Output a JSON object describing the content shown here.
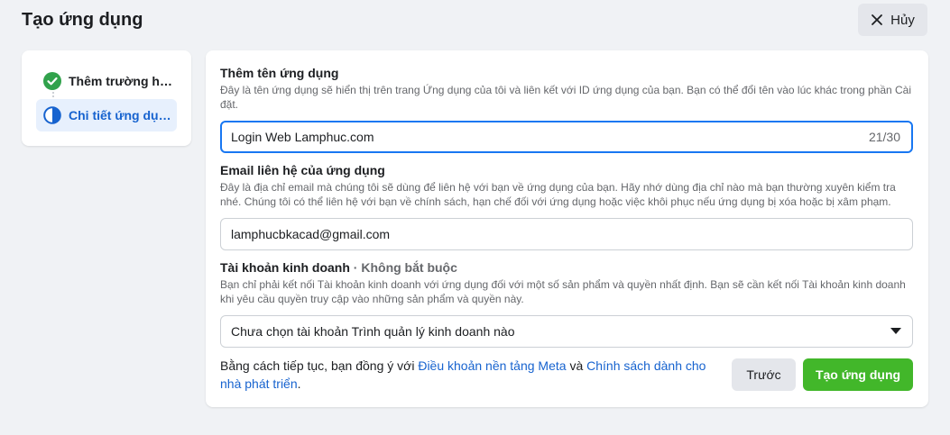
{
  "header": {
    "title": "Tạo ứng dụng",
    "cancel_label": "Hủy"
  },
  "steps": [
    {
      "label": "Thêm trường hợp sử dụng",
      "status": "completed",
      "icon": "check-circle-icon"
    },
    {
      "label": "Chi tiết ứng dụng",
      "status": "active",
      "icon": "half-circle-icon"
    }
  ],
  "form": {
    "app_name": {
      "title": "Thêm tên ứng dụng",
      "description": "Đây là tên ứng dụng sẽ hiển thị trên trang Ứng dụng của tôi và liên kết với ID ứng dụng của bạn. Bạn có thể đổi tên vào lúc khác trong phần Cài đặt.",
      "value": "Login Web Lamphuc.com",
      "counter": "21/30"
    },
    "contact_email": {
      "title": "Email liên hệ của ứng dụng",
      "description": "Đây là địa chỉ email mà chúng tôi sẽ dùng để liên hệ với bạn về ứng dụng của bạn. Hãy nhớ dùng địa chỉ nào mà bạn thường xuyên kiểm tra nhé. Chúng tôi có thể liên hệ với bạn về chính sách, hạn chế đối với ứng dụng hoặc việc khôi phục nếu ứng dụng bị xóa hoặc bị xâm phạm.",
      "value": "lamphucbkacad@gmail.com"
    },
    "business_account": {
      "title": "Tài khoản kinh doanh",
      "optional_label": "· Không bắt buộc",
      "description": "Bạn chỉ phải kết nối Tài khoản kinh doanh với ứng dụng đối với một số sản phẩm và quyền nhất định. Bạn sẽ cần kết nối Tài khoản kinh doanh khi yêu cầu quyền truy cập vào những sản phẩm và quyền này.",
      "selected": "Chưa chọn tài khoản Trình quản lý kinh doanh nào"
    }
  },
  "footer": {
    "terms_prefix": "Bằng cách tiếp tục, bạn đồng ý với ",
    "terms_link": "Điều khoản nền tảng Meta",
    "terms_middle": " và ",
    "policy_link": "Chính sách dành cho nhà phát triển",
    "terms_suffix": ".",
    "back_label": "Trước",
    "create_label": "Tạo ứng dụng"
  },
  "colors": {
    "accent_blue": "#1877f2",
    "link_blue": "#1763cf",
    "success_green": "#42b72a",
    "background": "#f0f2f5"
  }
}
